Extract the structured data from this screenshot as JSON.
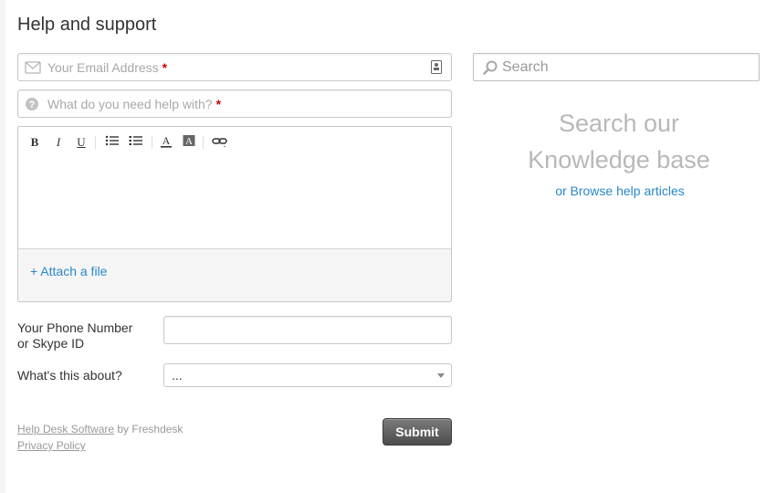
{
  "page": {
    "title": "Help and support"
  },
  "form": {
    "email": {
      "placeholder": "Your Email Address",
      "required_mark": "*"
    },
    "subject": {
      "placeholder": "What do you need help with?",
      "required_mark": "*"
    },
    "editor": {
      "toolbar": {
        "bold": "B",
        "italic": "I",
        "underline": "U",
        "font_color": "A"
      },
      "attach_label": "+ Attach a file"
    },
    "phone": {
      "label_line1": "Your Phone Number",
      "label_line2": "or Skype ID",
      "value": ""
    },
    "about": {
      "label": "What's this about?",
      "selected": "..."
    },
    "submit_label": "Submit"
  },
  "footer": {
    "software_link": "Help Desk Software",
    "by_text": " by Freshdesk",
    "privacy_link": "Privacy Policy"
  },
  "sidebar": {
    "search_placeholder": "Search",
    "kb_line1": "Search our",
    "kb_line2": "Knowledge base",
    "browse_link": "or Browse help articles"
  },
  "colors": {
    "link": "#2a87c8",
    "required": "#cc0000",
    "submit_bg": "#5a5a5a"
  }
}
